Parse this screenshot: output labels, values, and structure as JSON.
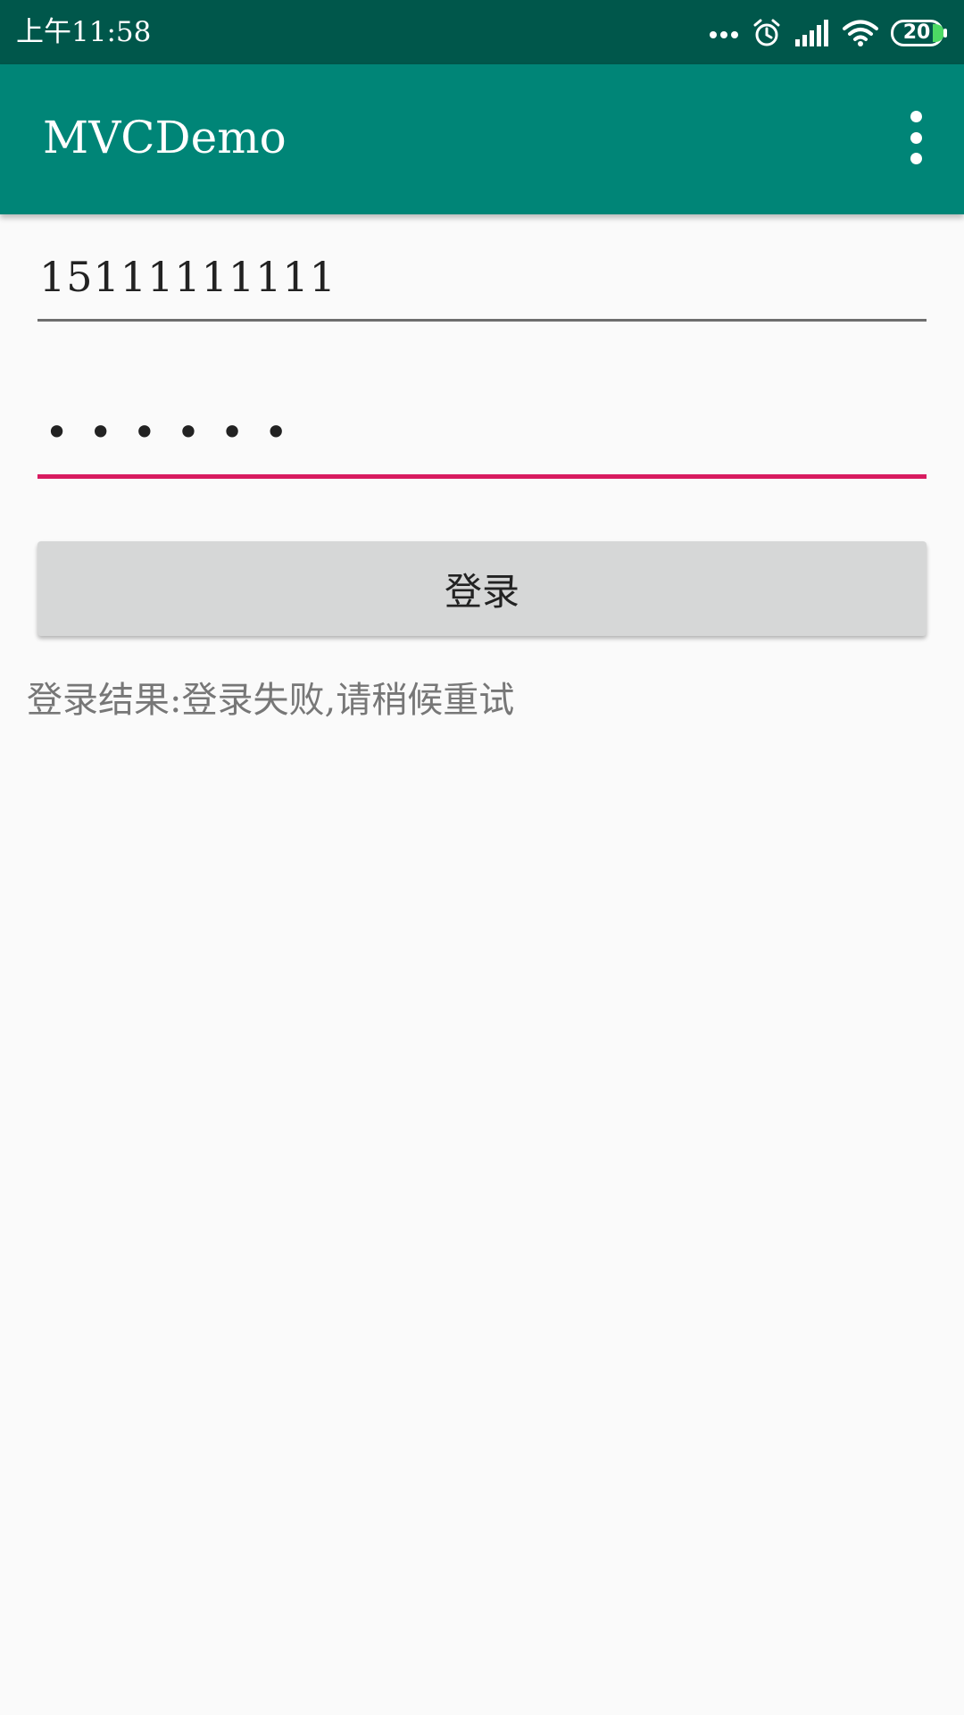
{
  "status_bar": {
    "time": "上午11:58",
    "icons": [
      "more-dots-icon",
      "alarm-icon",
      "signal-icon",
      "wifi-icon",
      "battery-icon"
    ],
    "battery_level": "20"
  },
  "app_bar": {
    "title": "MVCDemo",
    "overflow_icon": "more-vert-icon"
  },
  "form": {
    "phone_value": "15111111111",
    "password_masked": "••••••",
    "login_label": "登录"
  },
  "result": {
    "text": "登录结果:登录失败,请稍候重试"
  },
  "colors": {
    "status_bar": "#00574b",
    "app_bar": "#008577",
    "accent": "#d81b60",
    "button": "#d6d7d7",
    "battery_fill": "#4cd964"
  }
}
